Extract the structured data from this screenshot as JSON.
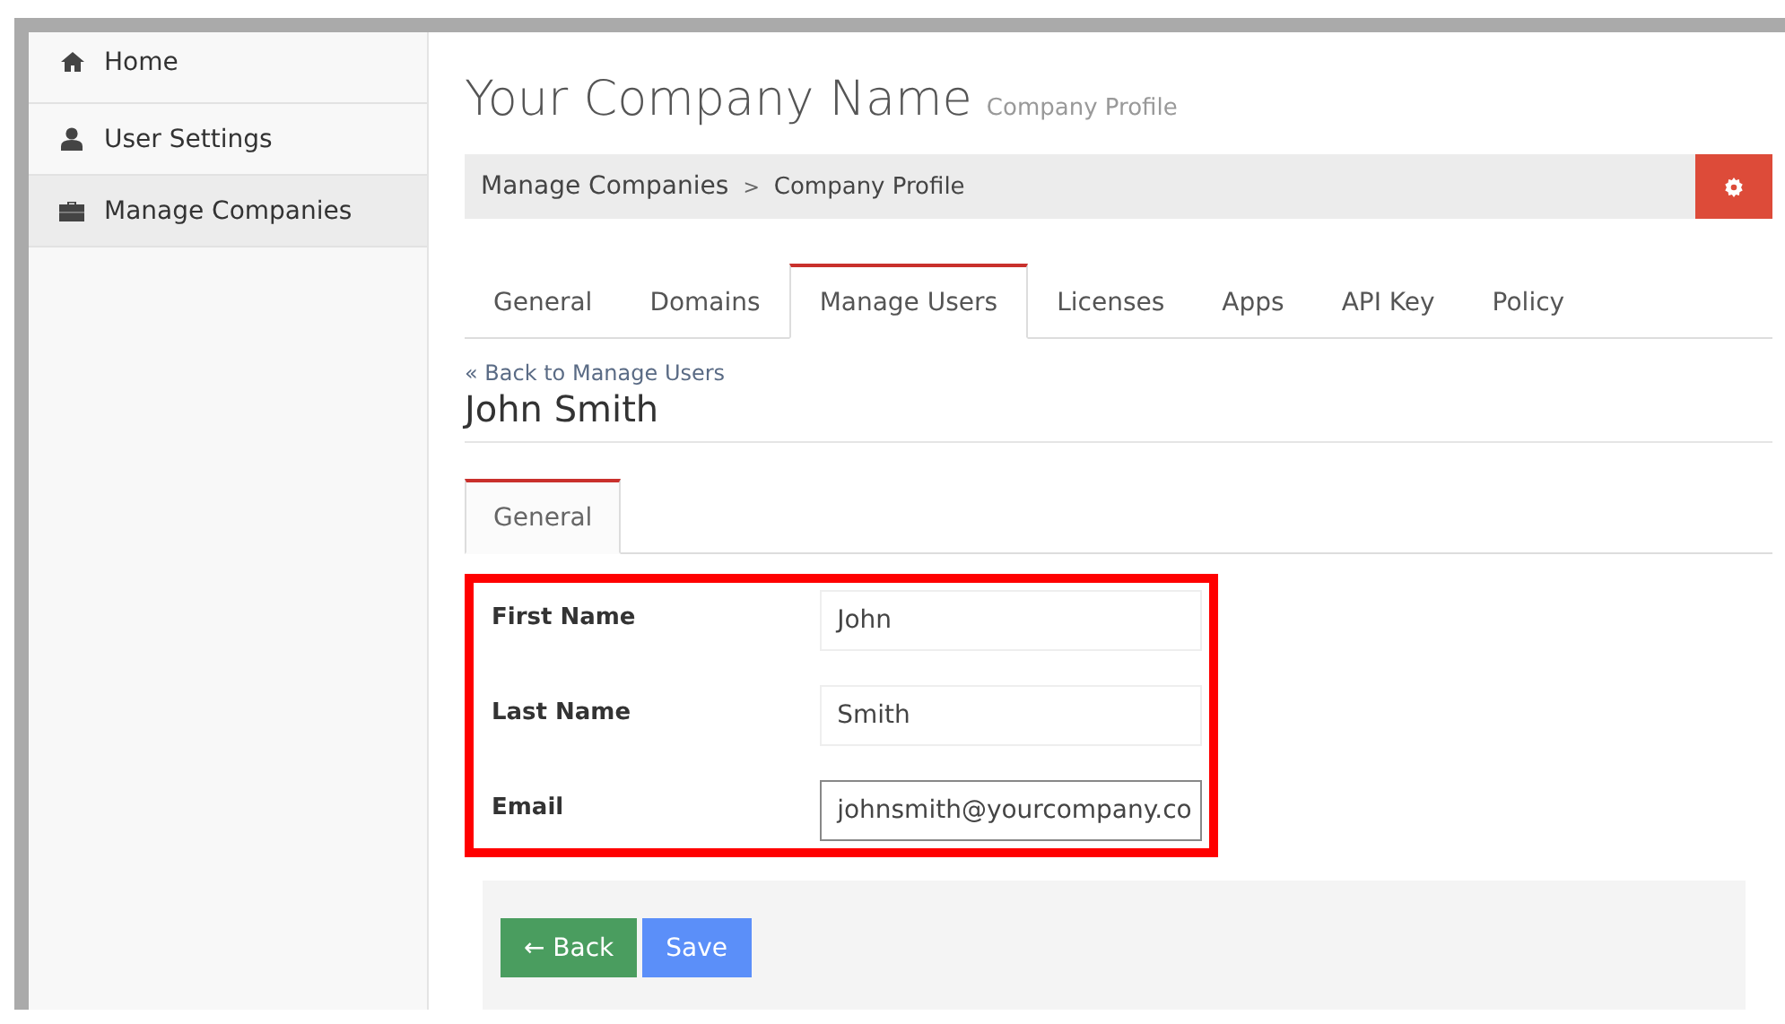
{
  "sidebar": {
    "items": [
      {
        "label": "Home",
        "kind": "home",
        "selected": false
      },
      {
        "label": "User Settings",
        "kind": "user",
        "selected": false
      },
      {
        "label": "Manage Companies",
        "kind": "briefcase",
        "selected": true
      }
    ]
  },
  "header": {
    "title": "Your Company Name",
    "subtitle": "Company Profile"
  },
  "breadcrumb": {
    "items": [
      "Manage Companies",
      "Company Profile"
    ],
    "separator": ">"
  },
  "tabs": [
    {
      "label": "General",
      "selected": false
    },
    {
      "label": "Domains",
      "selected": false
    },
    {
      "label": "Manage Users",
      "selected": true
    },
    {
      "label": "Licenses",
      "selected": false
    },
    {
      "label": "Apps",
      "selected": false
    },
    {
      "label": "API Key",
      "selected": false
    },
    {
      "label": "Policy",
      "selected": false
    }
  ],
  "back_link": "« Back to Manage Users",
  "user_name": "John Smith",
  "sub_tabs": [
    {
      "label": "General",
      "selected": true
    }
  ],
  "form": {
    "highlighted": true,
    "fields": [
      {
        "label": "First Name",
        "value": "John",
        "focused": false
      },
      {
        "label": "Last Name",
        "value": "Smith",
        "focused": false
      },
      {
        "label": "Email",
        "value": "johnsmith@yourcompany.co",
        "focused": true
      }
    ]
  },
  "buttons": [
    {
      "label": "← Back",
      "kind": "back"
    },
    {
      "label": "Save",
      "kind": "save"
    }
  ]
}
